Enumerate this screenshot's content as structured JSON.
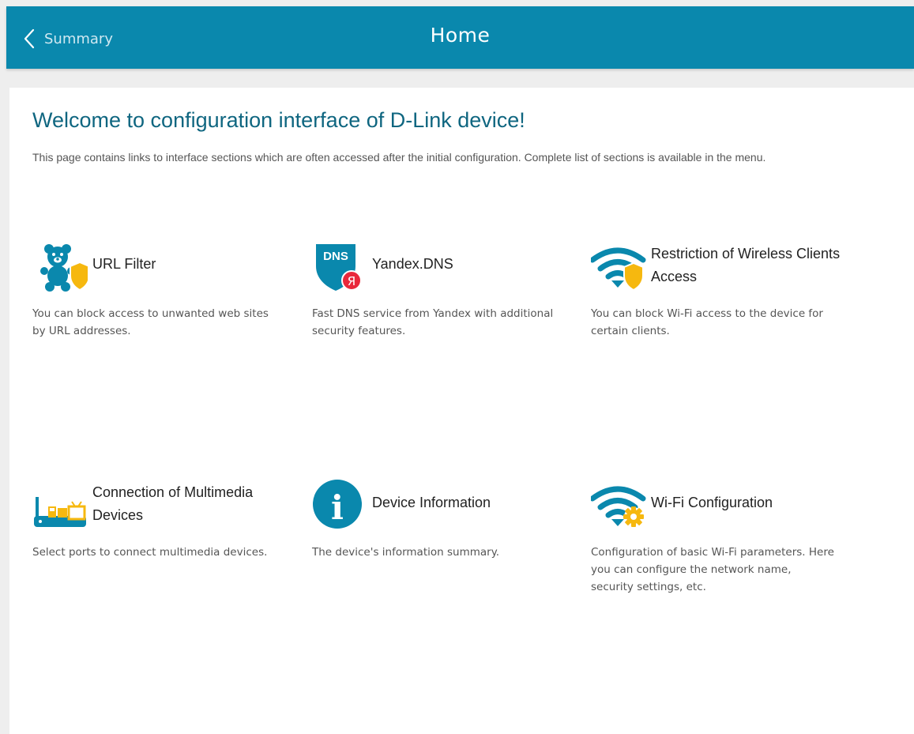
{
  "header": {
    "back_label": "Summary",
    "title": "Home"
  },
  "main": {
    "heading": "Welcome to configuration interface of D-Link device!",
    "intro": "This page contains links to interface sections which are often accessed after the initial configuration. Complete list of sections is available in the menu."
  },
  "tiles": [
    {
      "icon": "teddy-bear-shield-icon",
      "title": "URL Filter",
      "description": "You can block access to unwanted web sites by URL addresses."
    },
    {
      "icon": "dns-shield-icon",
      "title": "Yandex.DNS",
      "description": "Fast DNS service from Yandex with additional security features."
    },
    {
      "icon": "wifi-shield-icon",
      "title": "Restriction of Wireless Clients Access",
      "description": "You can block Wi-Fi access to the device for certain clients."
    },
    {
      "icon": "multimedia-devices-icon",
      "title": "Connection of Multimedia Devices",
      "description": "Select ports to connect multimedia devices."
    },
    {
      "icon": "info-icon",
      "title": "Device Information",
      "description": "The device's information summary."
    },
    {
      "icon": "wifi-gear-icon",
      "title": "Wi-Fi Configuration",
      "description": "Configuration of basic Wi-Fi parameters. Here you can configure the network name, security settings, etc."
    }
  ],
  "icon_badges": {
    "dns_text": "DNS",
    "yandex_letter": "Я",
    "info_letter": "i"
  },
  "colors": {
    "header_bg": "#0a88ad",
    "accent": "#0a88ad",
    "shield": "#f6b80f",
    "heading": "#0f6680",
    "yandex_red": "#e9283b"
  }
}
